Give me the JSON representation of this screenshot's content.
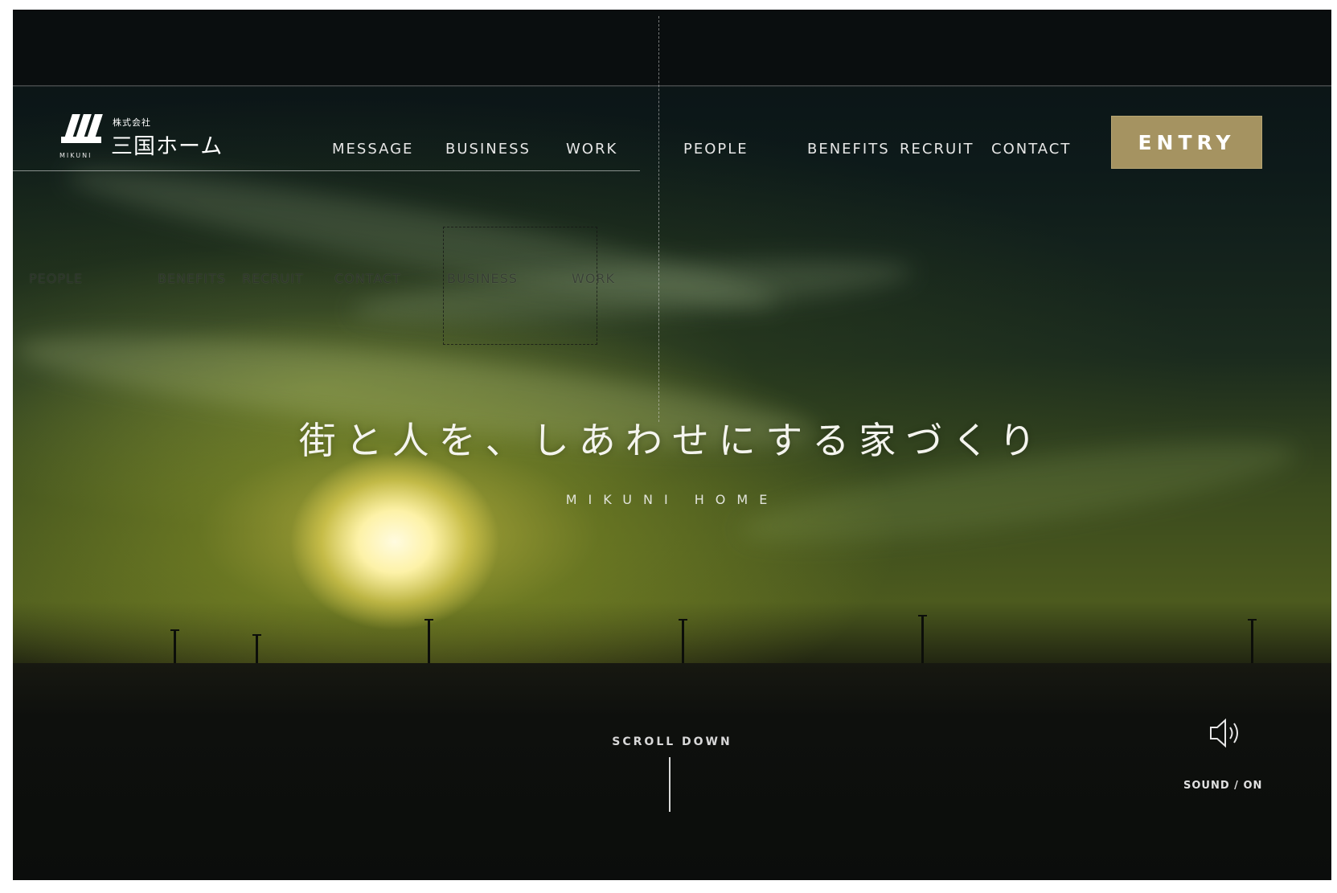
{
  "brand": {
    "kaisha": "株式会社",
    "name": "三国ホーム",
    "roman": "MIKUNI"
  },
  "nav": {
    "items": [
      {
        "label": "MESSAGE"
      },
      {
        "label": "BUSINESS"
      },
      {
        "label": "WORK"
      },
      {
        "label": "PEOPLE"
      },
      {
        "label": "BENEFITS"
      },
      {
        "label": "RECRUIT"
      },
      {
        "label": "CONTACT"
      }
    ],
    "entry_label": "ENTRY"
  },
  "hero": {
    "tagline": "街と人を、しあわせにする家づくり",
    "subtitle": "MIKUNI HOME"
  },
  "scroll": {
    "label": "SCROLL DOWN"
  },
  "sound": {
    "label": "SOUND / ON",
    "icon": "speaker-icon"
  },
  "ghost_layer": {
    "items": [
      "PEOPLE",
      "BENEFITS",
      "RECRUIT",
      "CONTACT",
      "BUSINESS",
      "WORK"
    ]
  },
  "colors": {
    "entry_button": "#a59361",
    "background": "#0a0c0c"
  }
}
